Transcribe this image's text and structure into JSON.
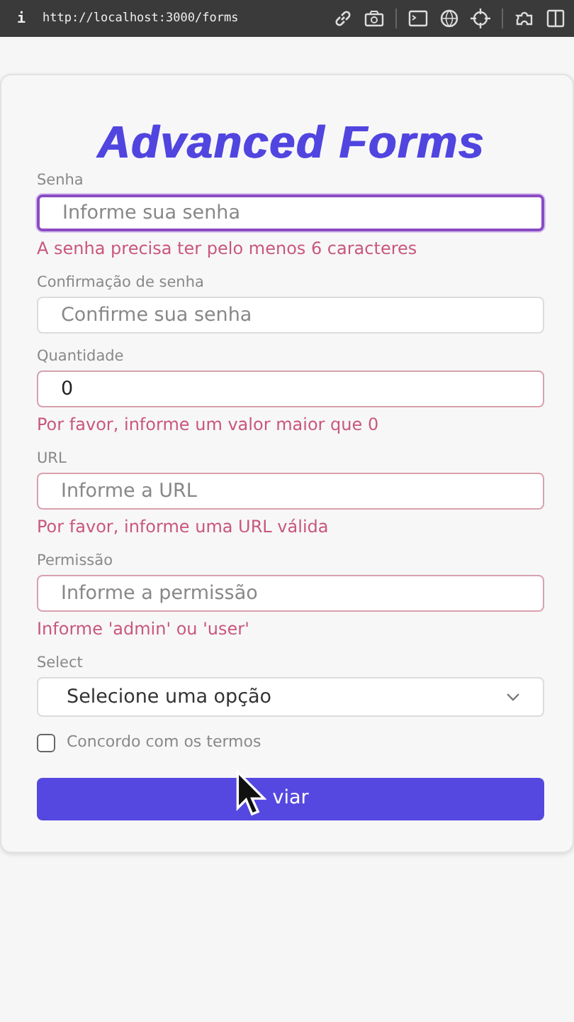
{
  "address_bar": {
    "info": "i",
    "url": "http://localhost:3000/forms"
  },
  "title": "Advanced Forms",
  "fields": [
    {
      "kind": "input",
      "label": "Senha",
      "placeholder": "Informe sua senha",
      "focused": true,
      "error": "A senha precisa ter pelo menos 6 caracteres"
    },
    {
      "kind": "input",
      "label": "Confirmação de senha",
      "placeholder": "Confirme sua senha",
      "focused": false
    },
    {
      "kind": "input",
      "label": "Quantidade",
      "value": "0",
      "focused": false,
      "error": "Por favor, informe um valor maior que 0"
    },
    {
      "kind": "input",
      "label": "URL",
      "placeholder": "Informe a URL",
      "focused": false,
      "error": "Por favor, informe uma URL válida"
    },
    {
      "kind": "input",
      "label": "Permissão",
      "placeholder": "Informe a permissão",
      "focused": false,
      "error": "Informe 'admin' ou 'user'"
    },
    {
      "kind": "select",
      "label": "Select",
      "placeholder": "Selecione uma opção",
      "focused": false
    }
  ],
  "checkbox": {
    "label": "Concordo com os termos",
    "checked": false
  },
  "submit": {
    "label": "viar"
  }
}
